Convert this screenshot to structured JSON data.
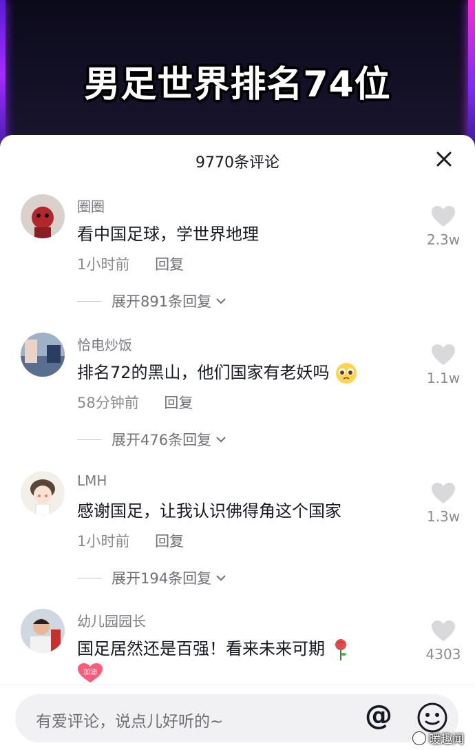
{
  "video": {
    "title": "男足世界排名74位"
  },
  "comments_panel": {
    "count_label": "9770条评论"
  },
  "comments": [
    {
      "username": "圈圈",
      "text": "看中国足球，学世界地理",
      "time": "1小时前",
      "reply_label": "回复",
      "expand_label": "展开891条回复",
      "likes": "2.3w"
    },
    {
      "username": "恰电炒饭",
      "text": "排名72的黑山，他们国家有老妖吗",
      "emoji": "pleading-face-emoji",
      "time": "58分钟前",
      "reply_label": "回复",
      "expand_label": "展开476条回复",
      "likes": "1.1w"
    },
    {
      "username": "LMH",
      "text": "感谢国足，让我认识佛得角这个国家",
      "time": "1小时前",
      "reply_label": "回复",
      "expand_label": "展开194条回复",
      "likes": "1.3w"
    },
    {
      "username": "幼儿园园长",
      "text": "国足居然还是百强！看来未来可期",
      "emoji": "rose-emoji",
      "sticker_text": "加油",
      "likes": "4303"
    }
  ],
  "input": {
    "placeholder": "有爱评论，说点儿好听的~",
    "at_symbol": "@"
  },
  "watermark": {
    "text": "暖趣闻"
  },
  "colors": {
    "text_primary": "#161823",
    "text_secondary": "#8a8b91",
    "like_heart": "#d9d9dc"
  }
}
